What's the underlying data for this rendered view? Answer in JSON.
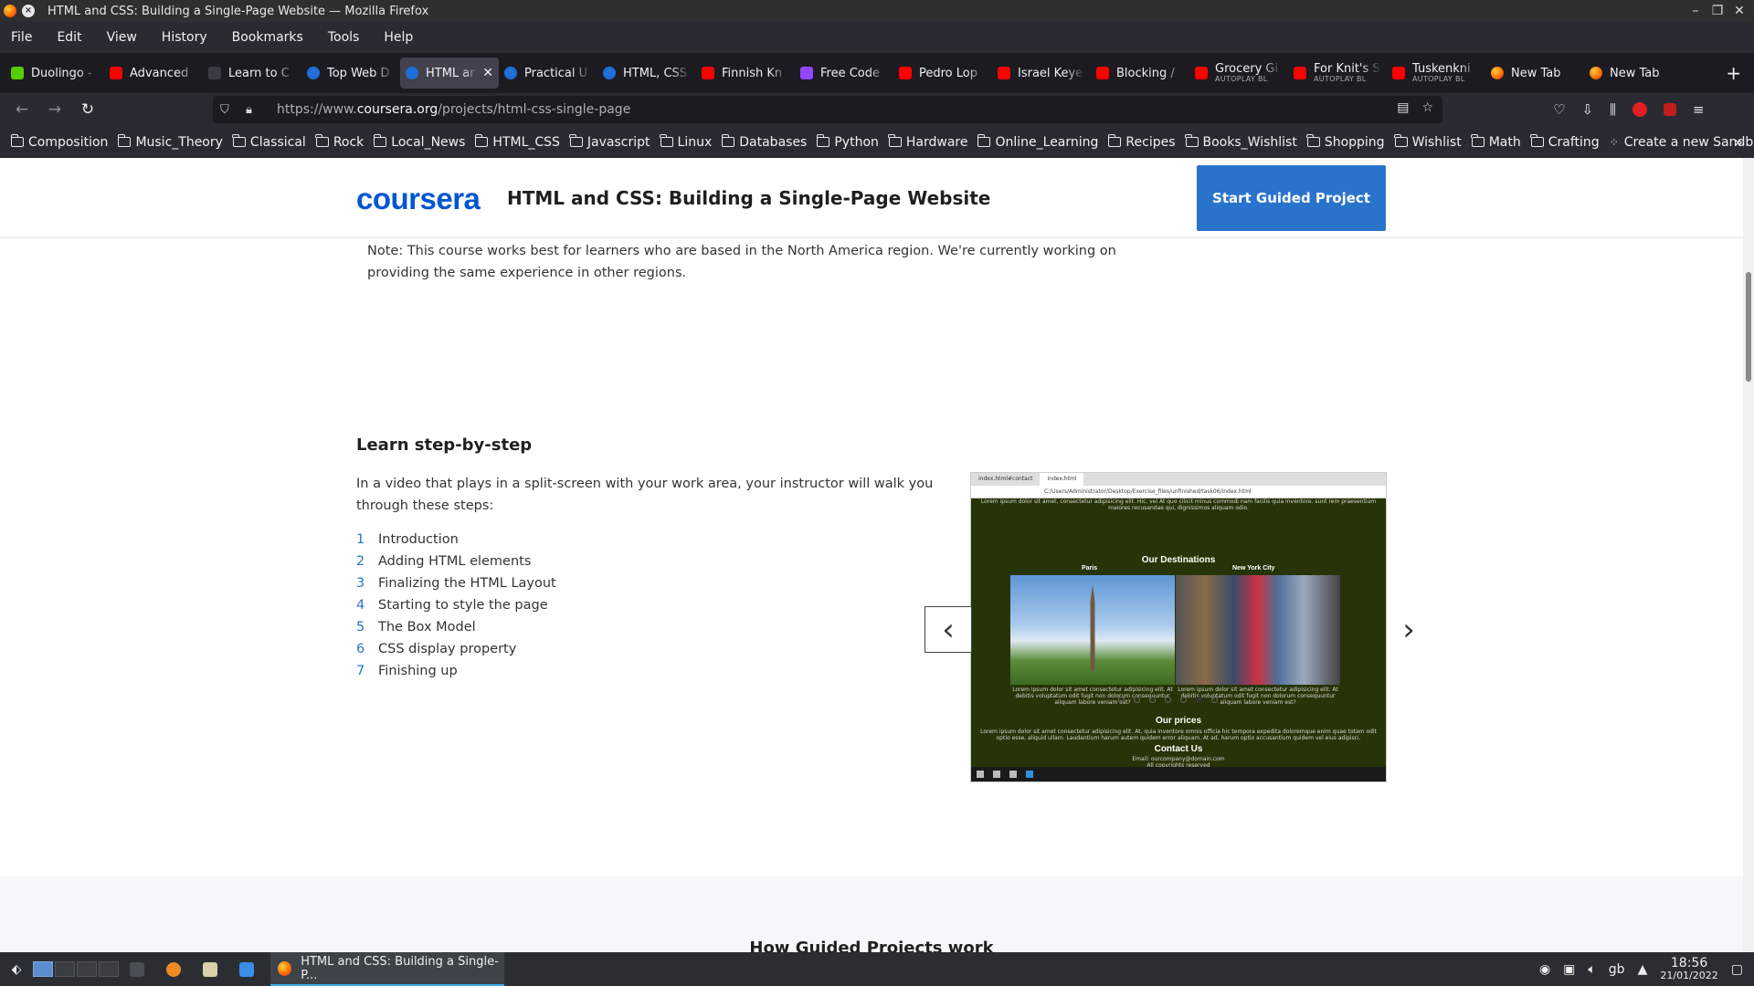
{
  "window": {
    "title": "HTML and CSS: Building a Single-Page Website — Mozilla Firefox"
  },
  "menu": [
    "File",
    "Edit",
    "View",
    "History",
    "Bookmarks",
    "Tools",
    "Help"
  ],
  "tabs": [
    {
      "label": "Duolingo -",
      "icon": "duo"
    },
    {
      "label": "Advanced",
      "icon": "yt"
    },
    {
      "label": "Learn to C",
      "icon": "lt"
    },
    {
      "label": "Top Web D",
      "icon": "cs"
    },
    {
      "label": "HTML ar",
      "icon": "cs",
      "active": true
    },
    {
      "label": "Practical U",
      "icon": "cs"
    },
    {
      "label": "HTML, CSS",
      "icon": "cs"
    },
    {
      "label": "Finnish Kn",
      "icon": "yt"
    },
    {
      "label": "Free Code",
      "icon": "tw"
    },
    {
      "label": "Pedro Lop",
      "icon": "yt"
    },
    {
      "label": "Israel Keye",
      "icon": "yt"
    },
    {
      "label": "Blocking /",
      "icon": "yt"
    },
    {
      "label": "Grocery Gi",
      "icon": "yt",
      "sub": "AUTOPLAY BL"
    },
    {
      "label": "For Knit's S",
      "icon": "yt",
      "sub": "AUTOPLAY BL"
    },
    {
      "label": "Tuskenkni",
      "icon": "yt",
      "sub": "AUTOPLAY BL"
    },
    {
      "label": "New Tab",
      "icon": "ff"
    },
    {
      "label": "New Tab",
      "icon": "ff"
    }
  ],
  "nav": {
    "url_prefix": "https://www.",
    "url_domain": "coursera.org",
    "url_path": "/projects/html-css-single-page"
  },
  "bookmarks": [
    "Composition",
    "Music_Theory",
    "Classical",
    "Rock",
    "Local_News",
    "HTML_CSS",
    "Javascript",
    "Linux",
    "Databases",
    "Python",
    "Hardware",
    "Online_Learning",
    "Recipes",
    "Books_Wishlist",
    "Shopping",
    "Wishlist",
    "Math",
    "Crafting"
  ],
  "bookmark_sandbox": "Create a new Sandbo...",
  "page": {
    "logo": "coursera",
    "course_title": "HTML and CSS: Building a Single-Page Website",
    "start_button": "Start Guided Project",
    "note": "Note: This course works best for learners who are based in the North America region. We're currently working on providing the same experience in other regions.",
    "steps_heading": "Learn step-by-step",
    "steps_intro": "In a video that plays in a split-screen with your work area, your instructor will walk you through these steps:",
    "steps": [
      {
        "num": "1",
        "label": "Introduction"
      },
      {
        "num": "2",
        "label": "Adding HTML elements"
      },
      {
        "num": "3",
        "label": "Finalizing the HTML Layout"
      },
      {
        "num": "4",
        "label": "Starting to style the page"
      },
      {
        "num": "5",
        "label": "The Box Model"
      },
      {
        "num": "6",
        "label": "CSS display property"
      },
      {
        "num": "7",
        "label": "Finishing up"
      }
    ],
    "carousel": {
      "active_dot": 6,
      "dot_count": 7
    },
    "screenshot": {
      "tab1": "index.html#contact",
      "tab2": "index.html",
      "address": "C:/Users/Administrator/Desktop/Exercise_files/unfinished/task06/index.html",
      "top_lorem": "Lorem ipsum dolor sit amet, consectetur adipisicing elit. Hic, vel At quo cilicit minus commodi nam facilis quia inventore. sunt rem praesentium maiores recusandae qui, dignissimos aliquam odio.",
      "destinations": "Our Destinations",
      "city1": "Paris",
      "city2": "New York City",
      "city_lorem": "Lorem ipsum dolor sit amet consectetur adipisicing elit. At debitis voluptatum odit fugit non dolorum consequuntur aliquam labore veniam est?",
      "prices": "Our prices",
      "prices_lorem": "Lorem ipsum dolor sit amet consectetur adipisicing elit. At, quia inventore omnis officia hic tempora expedita doloremque enim quae totam odit optio esse, aliquid ullam. Laudantium harum autem quidem error aliquam. At ad, harum optio accusantium quidem vel eius adipisci.",
      "contact": "Contact Us",
      "email": "Email: ourcompany@domain.com",
      "copyright": "All copyrights reserved"
    },
    "how_heading": "How Guided Projects work"
  },
  "taskbar": {
    "window_label": "HTML and CSS: Building a Single-P...",
    "keyboard": "gb",
    "time": "18:56",
    "date": "21/01/2022"
  }
}
